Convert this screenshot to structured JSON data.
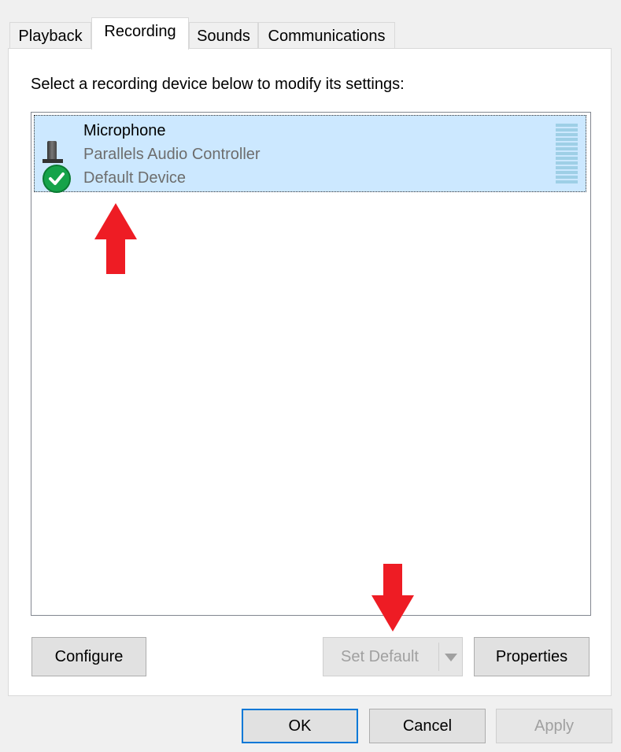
{
  "tabs": [
    {
      "label": "Playback"
    },
    {
      "label": "Recording",
      "active": true
    },
    {
      "label": "Sounds"
    },
    {
      "label": "Communications"
    }
  ],
  "instruction": "Select a recording device below to modify its settings:",
  "devices": [
    {
      "name": "Microphone",
      "controller": "Parallels Audio Controller",
      "status": "Default Device",
      "icon": "microphone-icon",
      "badge": "default-check-icon",
      "selected": true
    }
  ],
  "buttons": {
    "configure": "Configure",
    "set_default": "Set Default",
    "properties": "Properties",
    "ok": "OK",
    "cancel": "Cancel",
    "apply": "Apply"
  },
  "colors": {
    "selection": "#cce8ff",
    "focus_border": "#0078d7",
    "check_badge": "#15a34a",
    "annotation_arrow": "#ee1c24"
  }
}
